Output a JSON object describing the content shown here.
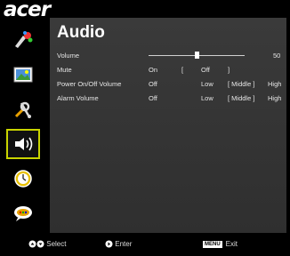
{
  "brand": "acer",
  "menu": {
    "title": "Audio",
    "items": [
      {
        "label": "Volume",
        "value": "50"
      },
      {
        "label": "Mute",
        "options": [
          "On",
          "[",
          "Off",
          "]"
        ]
      },
      {
        "label": "Power On/Off Volume",
        "options": [
          "Off",
          "Low",
          "[ Middle ]",
          "High"
        ]
      },
      {
        "label": "Alarm Volume",
        "options": [
          "Off",
          "Low",
          "[ Middle ]",
          "High"
        ]
      }
    ],
    "volume_level": 0.5
  },
  "sidebar": {
    "items": [
      {
        "icon": "color-settings-icon"
      },
      {
        "icon": "image-icon"
      },
      {
        "icon": "tools-icon"
      },
      {
        "icon": "audio-icon",
        "active": true
      },
      {
        "icon": "timer-icon"
      },
      {
        "icon": "language-icon"
      }
    ]
  },
  "footer": {
    "select_label": "Select",
    "enter_label": "Enter",
    "menu_key": "MENU",
    "exit_label": "Exit"
  },
  "colors": {
    "highlight": "#c9d400",
    "panel": "#353535"
  }
}
